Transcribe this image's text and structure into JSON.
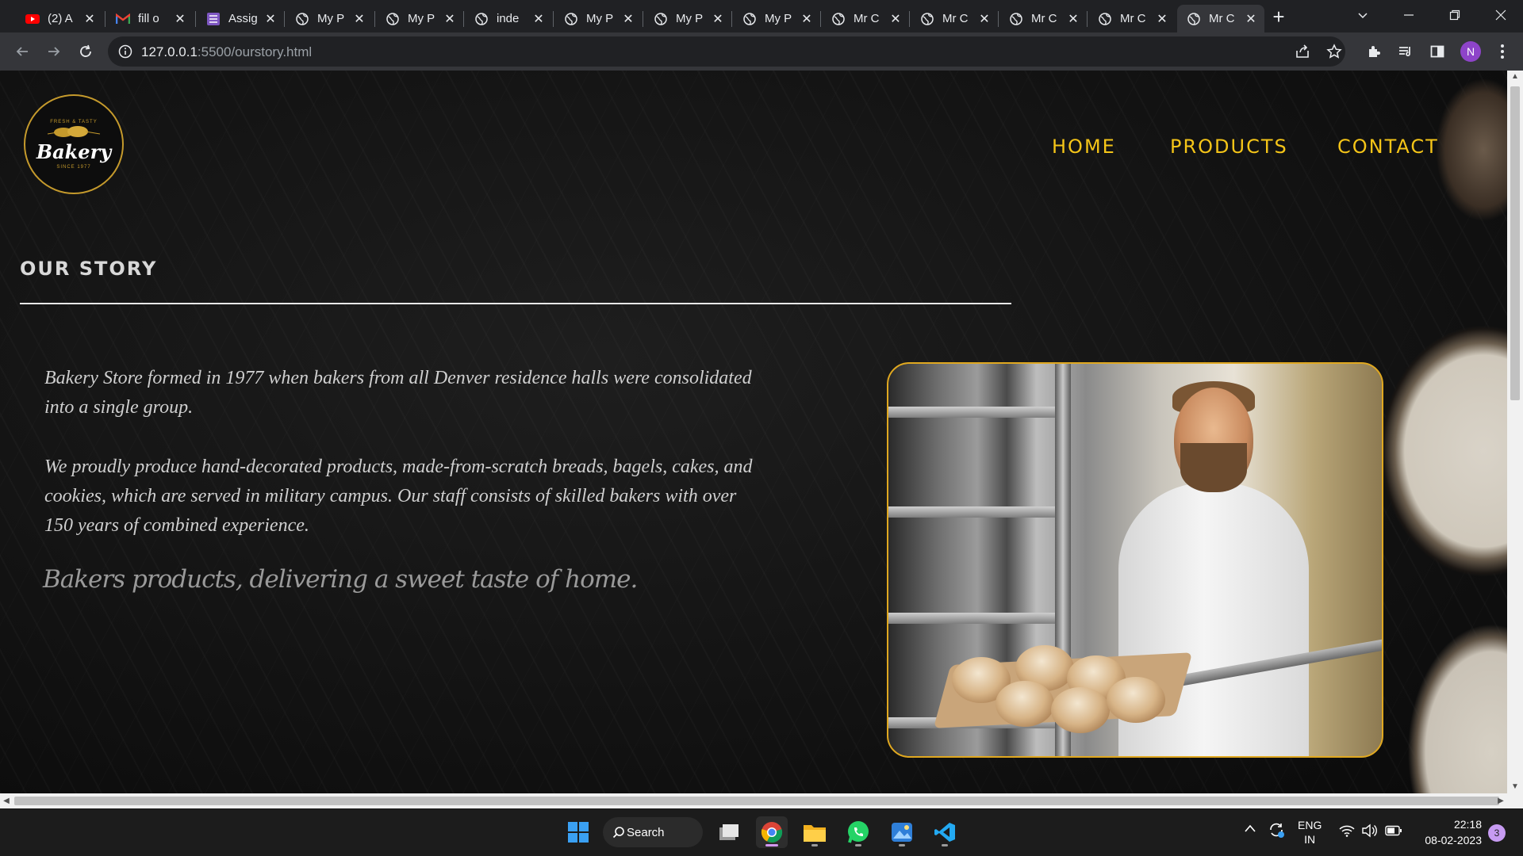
{
  "browser": {
    "tabs": [
      {
        "title": "(2) A",
        "icon": "youtube-icon"
      },
      {
        "title": "fill o",
        "icon": "gmail-icon"
      },
      {
        "title": "Assig",
        "icon": "classroom-icon"
      },
      {
        "title": "My P",
        "icon": "globe-icon"
      },
      {
        "title": "My P",
        "icon": "globe-icon"
      },
      {
        "title": "inde",
        "icon": "globe-icon"
      },
      {
        "title": "My P",
        "icon": "globe-icon"
      },
      {
        "title": "My P",
        "icon": "globe-icon"
      },
      {
        "title": "My P",
        "icon": "globe-icon"
      },
      {
        "title": "Mr C",
        "icon": "globe-icon"
      },
      {
        "title": "Mr C",
        "icon": "globe-icon"
      },
      {
        "title": "Mr C",
        "icon": "globe-icon"
      },
      {
        "title": "Mr C",
        "icon": "globe-icon"
      },
      {
        "title": "Mr C",
        "icon": "globe-icon",
        "active": true
      }
    ],
    "new_tab_label": "+",
    "url_host": "127.0.0.1",
    "url_rest": ":5500/ourstory.html",
    "profile_initial": "N"
  },
  "site": {
    "logo": {
      "arc_text": "FRESH & TASTY",
      "brand": "Bakery",
      "since": "SINCE 1977"
    },
    "nav": {
      "home": "HOME",
      "products": "PRODUCTS",
      "contact": "CONTACT"
    },
    "section_title": "OUR STORY",
    "paragraph1_line1": "Bakery Store formed in 1977 when bakers from all Denver residence halls were consolidated",
    "paragraph1_line2": "into a single group.",
    "paragraph2_line1": "We proudly produce hand-decorated products, made-from-scratch breads, bagels, cakes, and",
    "paragraph2_line2": "cookies, which are served in military campus. Our staff consists of skilled bakers with over",
    "paragraph2_line3": "150 years of combined experience.",
    "tagline": "Bakers products, delivering a sweet taste of home.",
    "photo_alt": "Baker holding fresh bread loaves from oven"
  },
  "taskbar": {
    "search_label": "Search",
    "lang_top": "ENG",
    "lang_bottom": "IN",
    "time": "22:18",
    "date": "08-02-2023",
    "notification_count": "3"
  },
  "colors": {
    "nav_accent": "#f5c518",
    "photo_border": "#e0a820",
    "logo_gold": "#c59a2c"
  }
}
